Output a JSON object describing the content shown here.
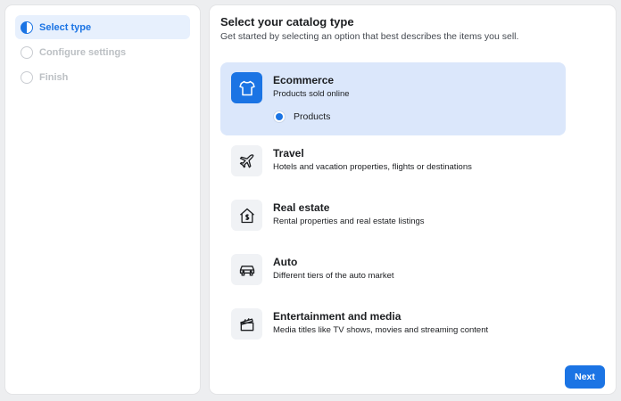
{
  "steps": [
    {
      "label": "Select type",
      "state": "active"
    },
    {
      "label": "Configure settings",
      "state": "inactive"
    },
    {
      "label": "Finish",
      "state": "inactive"
    }
  ],
  "main": {
    "title": "Select your catalog type",
    "subtitle": "Get started by selecting an option that best describes the items you sell."
  },
  "options": [
    {
      "title": "Ecommerce",
      "desc": "Products sold online",
      "icon": "shirt-icon",
      "selected": true,
      "sub_option": "Products"
    },
    {
      "title": "Travel",
      "desc": "Hotels and vacation properties, flights or destinations",
      "icon": "plane-icon"
    },
    {
      "title": "Real estate",
      "desc": "Rental properties and real estate listings",
      "icon": "house-dollar-icon"
    },
    {
      "title": "Auto",
      "desc": "Different tiers of the auto market",
      "icon": "car-icon"
    },
    {
      "title": "Entertainment and media",
      "desc": "Media titles like TV shows, movies and streaming content",
      "icon": "clapperboard-icon"
    }
  ],
  "actions": {
    "next_label": "Next"
  },
  "colors": {
    "accent": "#1b74e4",
    "selected_bg": "#dbe7fb",
    "page_bg": "#edeef0"
  }
}
